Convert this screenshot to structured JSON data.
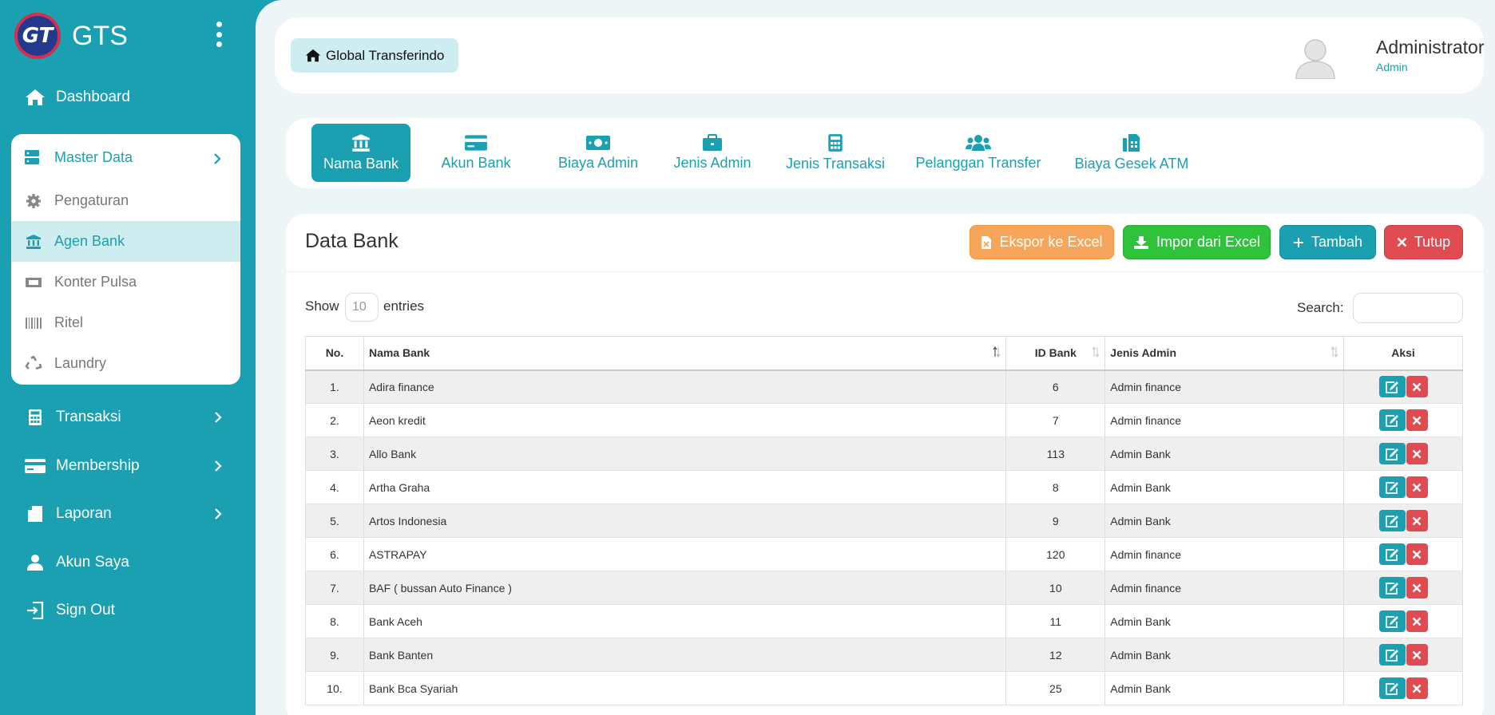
{
  "brand": {
    "logo_text": "GT",
    "name": "GTS"
  },
  "sidebar": {
    "items": [
      {
        "label": "Dashboard",
        "icon": "home-icon"
      },
      {
        "label": "Transaksi",
        "icon": "calculator-icon"
      },
      {
        "label": "Membership",
        "icon": "credit-card-icon"
      },
      {
        "label": "Laporan",
        "icon": "file-icon"
      },
      {
        "label": "Akun Saya",
        "icon": "user-icon"
      },
      {
        "label": "Sign Out",
        "icon": "sign-out-icon"
      }
    ],
    "master": {
      "label": "Master Data",
      "icon": "server-icon",
      "items": [
        {
          "label": "Pengaturan",
          "icon": "gear-icon"
        },
        {
          "label": "Agen Bank",
          "icon": "bank-icon",
          "active": true
        },
        {
          "label": "Konter Pulsa",
          "icon": "ticket-icon"
        },
        {
          "label": "Ritel",
          "icon": "barcode-icon"
        },
        {
          "label": "Laundry",
          "icon": "recycle-icon"
        }
      ]
    }
  },
  "header": {
    "home_label": "Global Transferindo",
    "user_name": "Administrator",
    "user_role": "Admin"
  },
  "tabs": [
    {
      "label": "Nama Bank",
      "icon": "bank-icon",
      "active": true
    },
    {
      "label": "Akun Bank",
      "icon": "credit-card-icon"
    },
    {
      "label": "Biaya Admin",
      "icon": "money-icon"
    },
    {
      "label": "Jenis Admin",
      "icon": "briefcase-icon"
    },
    {
      "label": "Jenis Transaksi",
      "icon": "calculator-icon"
    },
    {
      "label": "Pelanggan Transfer",
      "icon": "users-icon"
    },
    {
      "label": "Biaya Gesek ATM",
      "icon": "fax-icon"
    }
  ],
  "card": {
    "title": "Data Bank",
    "buttons": {
      "export": "Ekspor ke Excel",
      "import": "Impor dari Excel",
      "add": "Tambah",
      "close": "Tutup"
    },
    "show_label": "Show",
    "page_length": "10",
    "entries_label": "entries",
    "search_label": "Search:",
    "search_value": ""
  },
  "table": {
    "headers": {
      "no": "No.",
      "nama": "Nama Bank",
      "id": "ID Bank",
      "jenis": "Jenis Admin",
      "aksi": "Aksi"
    },
    "rows": [
      {
        "no": "1.",
        "nama": "Adira finance",
        "id": "6",
        "jenis": "Admin finance"
      },
      {
        "no": "2.",
        "nama": "Aeon kredit",
        "id": "7",
        "jenis": "Admin finance"
      },
      {
        "no": "3.",
        "nama": "Allo Bank",
        "id": "113",
        "jenis": "Admin Bank"
      },
      {
        "no": "4.",
        "nama": "Artha Graha",
        "id": "8",
        "jenis": "Admin Bank"
      },
      {
        "no": "5.",
        "nama": "Artos Indonesia",
        "id": "9",
        "jenis": "Admin Bank"
      },
      {
        "no": "6.",
        "nama": "ASTRAPAY",
        "id": "120",
        "jenis": "Admin finance"
      },
      {
        "no": "7.",
        "nama": "BAF ( bussan Auto Finance )",
        "id": "10",
        "jenis": "Admin finance"
      },
      {
        "no": "8.",
        "nama": "Bank Aceh",
        "id": "11",
        "jenis": "Admin Bank"
      },
      {
        "no": "9.",
        "nama": "Bank Banten",
        "id": "12",
        "jenis": "Admin Bank"
      },
      {
        "no": "10.",
        "nama": "Bank Bca Syariah",
        "id": "25",
        "jenis": "Admin Bank"
      }
    ]
  },
  "colors": {
    "primary": "#1ba0b2",
    "export": "#f7a55a",
    "import": "#2fc23b",
    "danger": "#e04b52"
  }
}
